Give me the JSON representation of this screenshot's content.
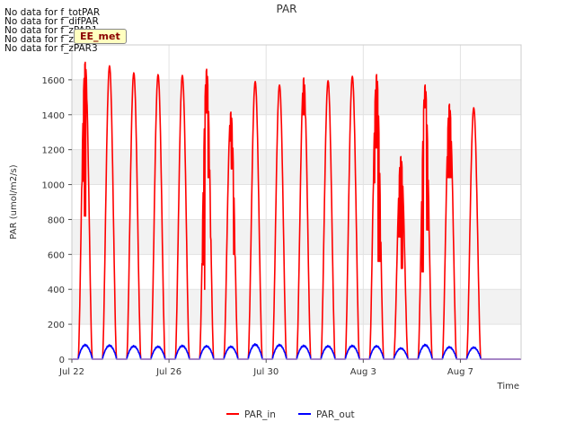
{
  "chart_data": {
    "type": "line",
    "title": "PAR",
    "xlabel": "Time",
    "ylabel": "PAR (umol/m2/s)",
    "x_unit": "days",
    "xlim": [
      "2023-07-22",
      "2023-08-09 12:00"
    ],
    "ylim": [
      0,
      1800
    ],
    "yticks": [
      0,
      200,
      400,
      600,
      800,
      1000,
      1200,
      1400,
      1600
    ],
    "xticks": [
      {
        "date": "2023-07-22",
        "label": "Jul 22"
      },
      {
        "date": "2023-07-26",
        "label": "Jul 26"
      },
      {
        "date": "2023-07-30",
        "label": "Jul 30"
      },
      {
        "date": "2023-08-03",
        "label": "Aug 3"
      },
      {
        "date": "2023-08-07",
        "label": "Aug 7"
      }
    ],
    "grid": true,
    "background_bands": true,
    "legend_position": "bottom-center",
    "series": [
      {
        "name": "PAR_in",
        "color": "#ff0000",
        "daily_peaks": [
          {
            "date": "2023-07-22",
            "peak": 1700,
            "spikes": [
              1020,
              820,
              1490
            ]
          },
          {
            "date": "2023-07-23",
            "peak": 1680
          },
          {
            "date": "2023-07-24",
            "peak": 1640
          },
          {
            "date": "2023-07-25",
            "peak": 1630
          },
          {
            "date": "2023-07-26",
            "peak": 1625
          },
          {
            "date": "2023-07-27",
            "peak": 1660,
            "spikes": [
              540,
              400,
              1410,
              1040,
              700
            ]
          },
          {
            "date": "2023-07-28",
            "peak": 1415,
            "spikes": [
              1300,
              1250,
              1090,
              600
            ]
          },
          {
            "date": "2023-07-29",
            "peak": 1590
          },
          {
            "date": "2023-07-30",
            "peak": 1570
          },
          {
            "date": "2023-07-31",
            "peak": 1610,
            "spikes": [
              1400
            ]
          },
          {
            "date": "2023-08-01",
            "peak": 1595
          },
          {
            "date": "2023-08-02",
            "peak": 1620
          },
          {
            "date": "2023-08-03",
            "peak": 1630,
            "spikes": [
              1010,
              1210,
              560
            ]
          },
          {
            "date": "2023-08-04",
            "peak": 1160,
            "spikes": [
              870,
              700,
              520,
              970
            ]
          },
          {
            "date": "2023-08-05",
            "peak": 1570,
            "spikes": [
              500,
              1440,
              740
            ]
          },
          {
            "date": "2023-08-06",
            "peak": 1460,
            "spikes": [
              1040
            ]
          },
          {
            "date": "2023-08-07",
            "peak": 1440
          }
        ]
      },
      {
        "name": "PAR_out",
        "color": "#0000ff",
        "daily_peaks": [
          {
            "date": "2023-07-22",
            "peak": 85
          },
          {
            "date": "2023-07-23",
            "peak": 82
          },
          {
            "date": "2023-07-24",
            "peak": 78
          },
          {
            "date": "2023-07-25",
            "peak": 75
          },
          {
            "date": "2023-07-26",
            "peak": 80
          },
          {
            "date": "2023-07-27",
            "peak": 78
          },
          {
            "date": "2023-07-28",
            "peak": 75
          },
          {
            "date": "2023-07-29",
            "peak": 88
          },
          {
            "date": "2023-07-30",
            "peak": 85
          },
          {
            "date": "2023-07-31",
            "peak": 80
          },
          {
            "date": "2023-08-01",
            "peak": 78
          },
          {
            "date": "2023-08-02",
            "peak": 80
          },
          {
            "date": "2023-08-03",
            "peak": 78
          },
          {
            "date": "2023-08-04",
            "peak": 65
          },
          {
            "date": "2023-08-05",
            "peak": 85
          },
          {
            "date": "2023-08-06",
            "peak": 72
          },
          {
            "date": "2023-08-07",
            "peak": 70
          }
        ]
      }
    ]
  },
  "no_data_messages": [
    "No data for f_totPAR",
    "No data for f_difPAR",
    "No data for f_zPAR1",
    "No data for f_zPAR2",
    "No data for f_zPAR3"
  ],
  "badge": {
    "label": "EE_met"
  }
}
